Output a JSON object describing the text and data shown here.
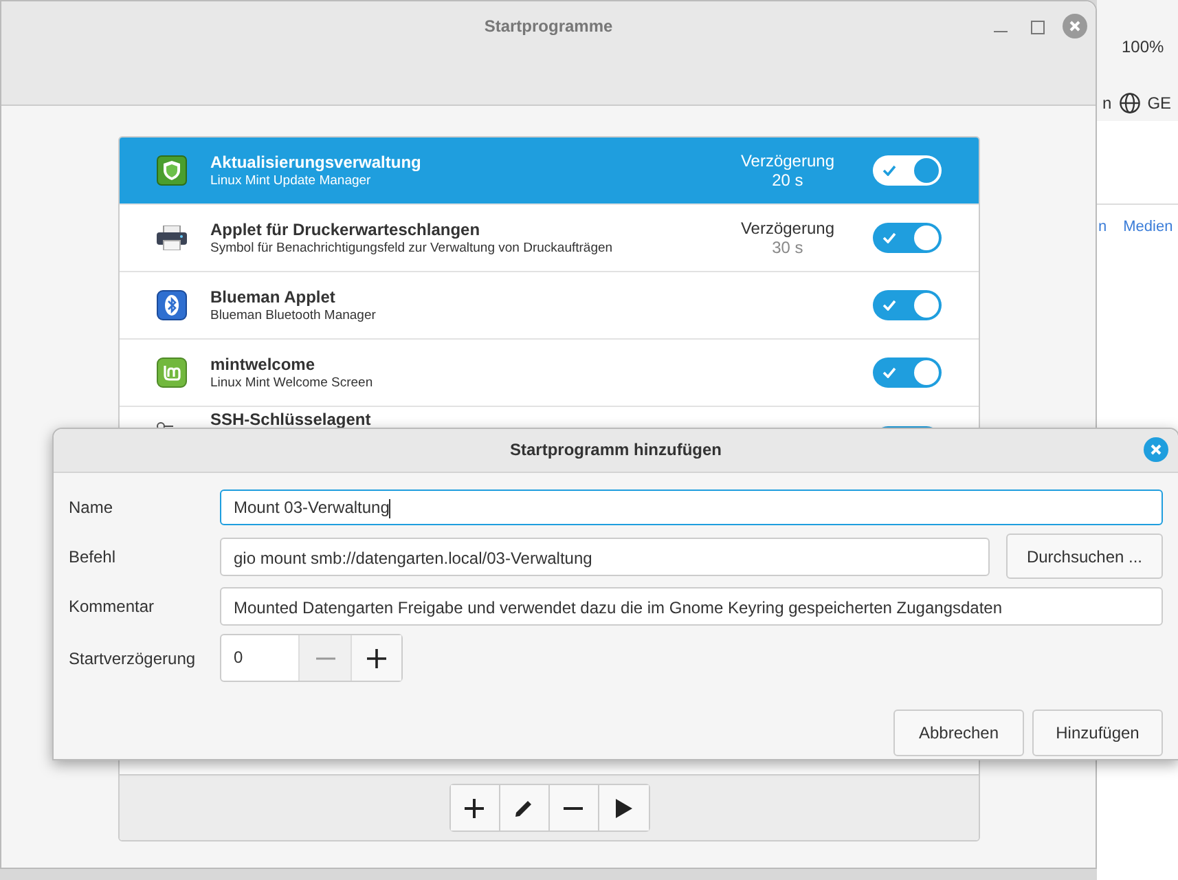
{
  "background_window": {
    "zoom": "100%",
    "toolbar_text": "n",
    "language": "GE",
    "link_partial": "n",
    "link": "Medien"
  },
  "window": {
    "title": "Startprogramme"
  },
  "rows": [
    {
      "title": "Aktualisierungsverwaltung",
      "subtitle": "Linux Mint Update Manager",
      "delay_label": "Verzögerung",
      "delay": "20 s",
      "enabled": true,
      "selected": true
    },
    {
      "title": "Applet für Druckerwarteschlangen",
      "subtitle": "Symbol für Benachrichtigungsfeld zur Verwaltung von Druckaufträgen",
      "delay_label": "Verzögerung",
      "delay": "30 s",
      "enabled": true,
      "selected": false
    },
    {
      "title": "Blueman Applet",
      "subtitle": "Blueman Bluetooth Manager",
      "enabled": true,
      "selected": false
    },
    {
      "title": "mintwelcome",
      "subtitle": "Linux Mint Welcome Screen",
      "enabled": true,
      "selected": false
    },
    {
      "title": "SSH-Schlüsselagent",
      "enabled": true,
      "selected": false
    }
  ],
  "dialog": {
    "title": "Startprogramm hinzufügen",
    "fields": [
      {
        "label": "Name",
        "value": "Mount 03-Verwaltung",
        "focused": true
      },
      {
        "label": "Befehl",
        "value": "gio mount smb://datengarten.local/03-Verwaltung",
        "button": "Durchsuchen ..."
      },
      {
        "label": "Kommentar",
        "value": "Mounted Datengarten Freigabe und verwendet dazu die im Gnome Keyring gespeicherten Zugangsdaten"
      }
    ],
    "delay": {
      "label": "Startverzögerung",
      "value": "0",
      "minus_disabled": true
    },
    "buttons": [
      "Abbrechen",
      "Hinzufügen"
    ]
  }
}
